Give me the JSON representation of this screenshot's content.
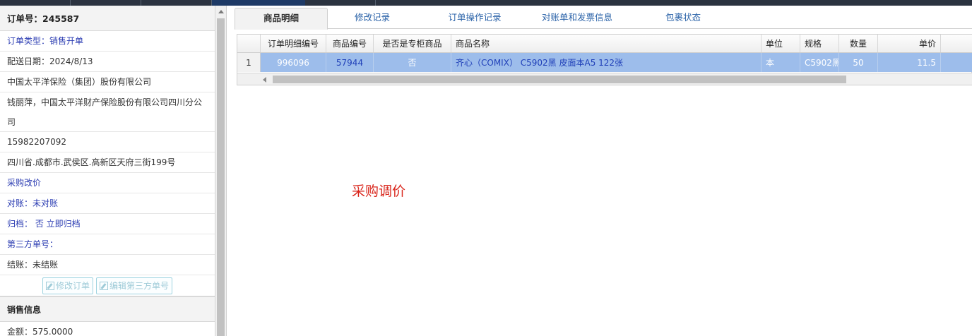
{
  "order": {
    "header": "订单号：245587",
    "rows": [
      {
        "label": "订单类型：销售开单",
        "style": "blue"
      },
      {
        "label": "配送日期：2024/8/13",
        "style": "plain"
      },
      {
        "label": "中国太平洋保险（集团）股份有限公司",
        "style": "plain"
      },
      {
        "label": "钱丽萍，中国太平洋财产保险股份有限公司四川分公司",
        "style": "wrap"
      },
      {
        "label": "15982207092",
        "style": "plain"
      },
      {
        "label": "四川省.成都市.武侯区.高新区天府三街199号",
        "style": "plain"
      },
      {
        "label": "采购改价",
        "style": "blue"
      },
      {
        "label": "对账：未对账",
        "style": "blue"
      },
      {
        "label": "归档： 否 立即归档",
        "style": "blue"
      },
      {
        "label": "第三方单号：",
        "style": "blue"
      },
      {
        "label": "结账：未结账",
        "style": "plain"
      }
    ],
    "buttons": {
      "edit_order": "修改订单",
      "edit_third_party": "编辑第三方单号"
    },
    "sales_section": "销售信息",
    "amount": "金额：575.0000"
  },
  "tabs": [
    "商品明细",
    "修改记录",
    "订单操作记录",
    "对账单和发票信息",
    "包裹状态"
  ],
  "grid": {
    "columns": [
      "订单明细编号",
      "商品编号",
      "是否是专柜商品",
      "商品名称",
      "单位",
      "规格",
      "数量",
      "单价"
    ],
    "rows": [
      {
        "index": "1",
        "detail_id": "996096",
        "product_id": "57944",
        "is_counter": "否",
        "name": "齐心（COMIX） C5902黑 皮面本A5 122张",
        "unit": "本",
        "spec": "C5902黑",
        "qty": "50",
        "price": "11.5"
      }
    ]
  },
  "annotation": "采购调价",
  "colors": {
    "selected_row": "#9dbdeb",
    "annotation": "#d9261c",
    "link": "#2b3cb2"
  }
}
